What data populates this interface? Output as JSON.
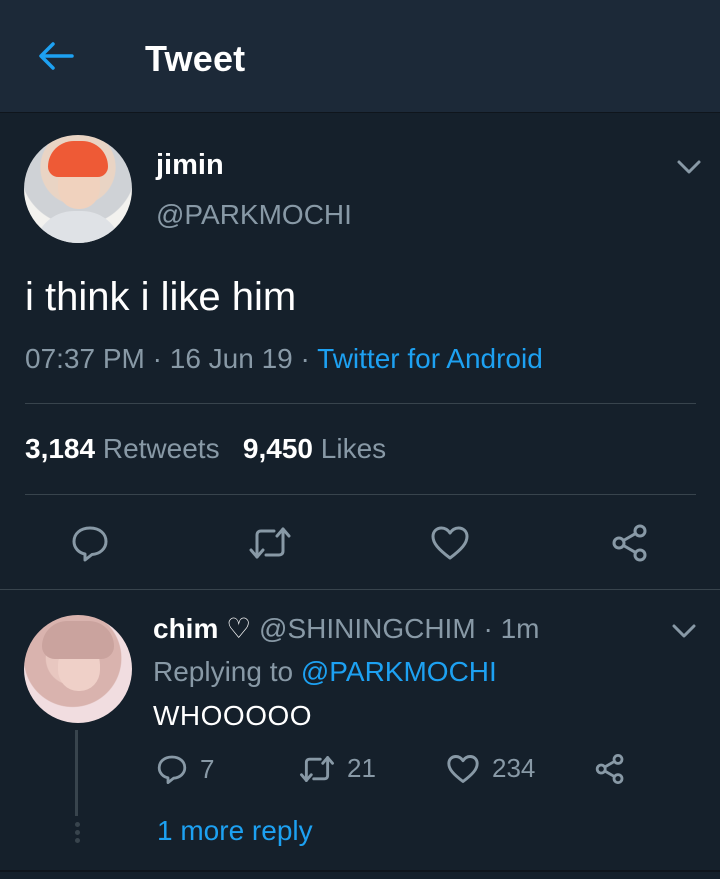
{
  "header": {
    "title": "Tweet",
    "back_icon": "arrow-left-icon"
  },
  "tweet": {
    "display_name": "jimin",
    "handle": "@PARKMOCHI",
    "text": "i think i like him",
    "time": "07:37 PM",
    "separator": " · ",
    "date": "16 Jun 19",
    "source": "Twitter for Android",
    "retweets_count": "3,184",
    "retweets_label": "Retweets",
    "likes_count": "9,450",
    "likes_label": "Likes",
    "actions": [
      "reply-icon",
      "retweet-icon",
      "like-icon",
      "share-icon"
    ]
  },
  "reply": {
    "display_name": "chim ♡",
    "handle": "@SHININGCHIM",
    "time_ago": "1m",
    "replying_prefix": "Replying to",
    "replying_to": "@PARKMOCHI",
    "text": "WHOOOOO",
    "reply_count": "7",
    "retweet_count": "21",
    "like_count": "234",
    "more_replies": "1 more reply"
  },
  "colors": {
    "background": "#15202b",
    "header": "#1c2938",
    "accent": "#1da1f2",
    "muted": "#8899a6",
    "divider": "#38444d"
  }
}
